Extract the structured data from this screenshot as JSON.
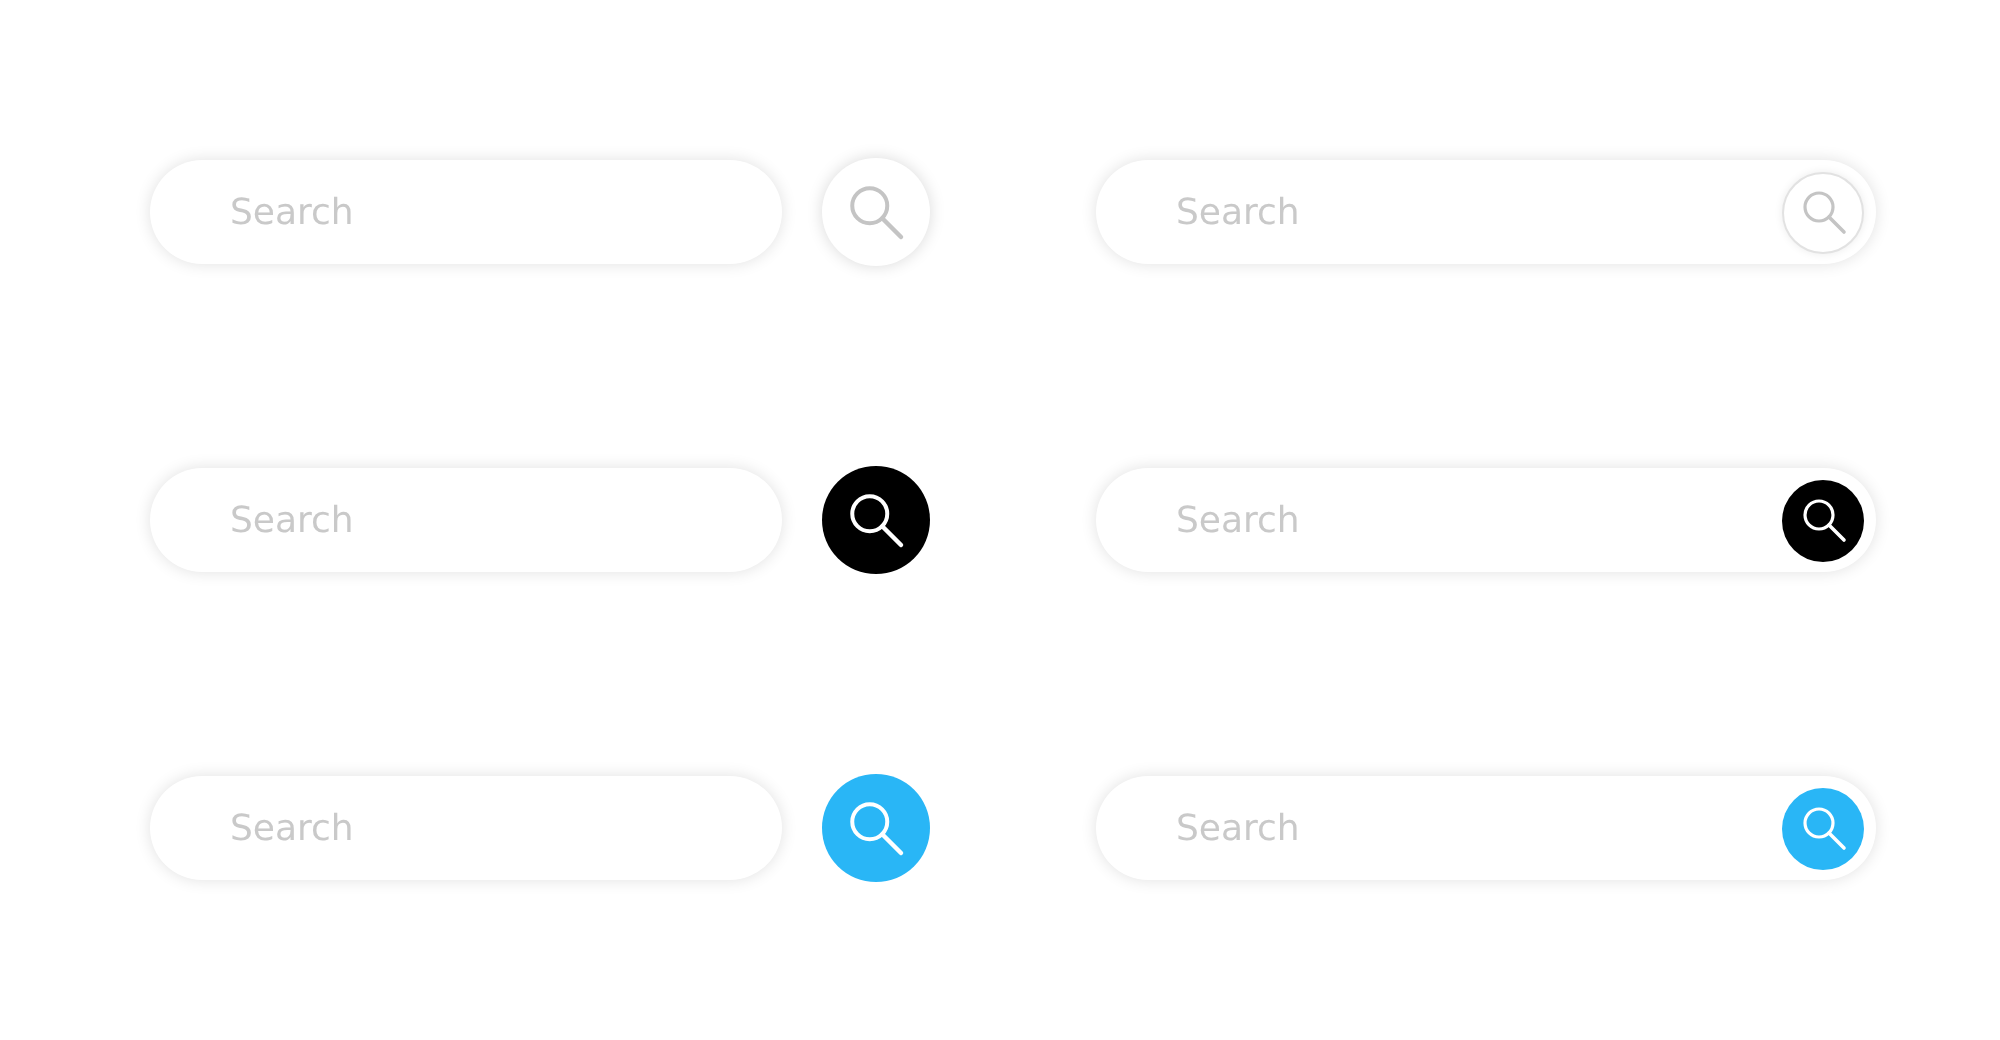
{
  "search_bars": [
    {
      "kind": "separate",
      "placeholder": "Search",
      "color": "#ffffff"
    },
    {
      "kind": "inset",
      "placeholder": "Search",
      "color": "#ffffff"
    },
    {
      "kind": "separate",
      "placeholder": "Search",
      "color": "#000000"
    },
    {
      "kind": "inset",
      "placeholder": "Search",
      "color": "#000000"
    },
    {
      "kind": "separate",
      "placeholder": "Search",
      "color": "#29b6f6"
    },
    {
      "kind": "inset",
      "placeholder": "Search",
      "color": "#29b6f6"
    }
  ]
}
